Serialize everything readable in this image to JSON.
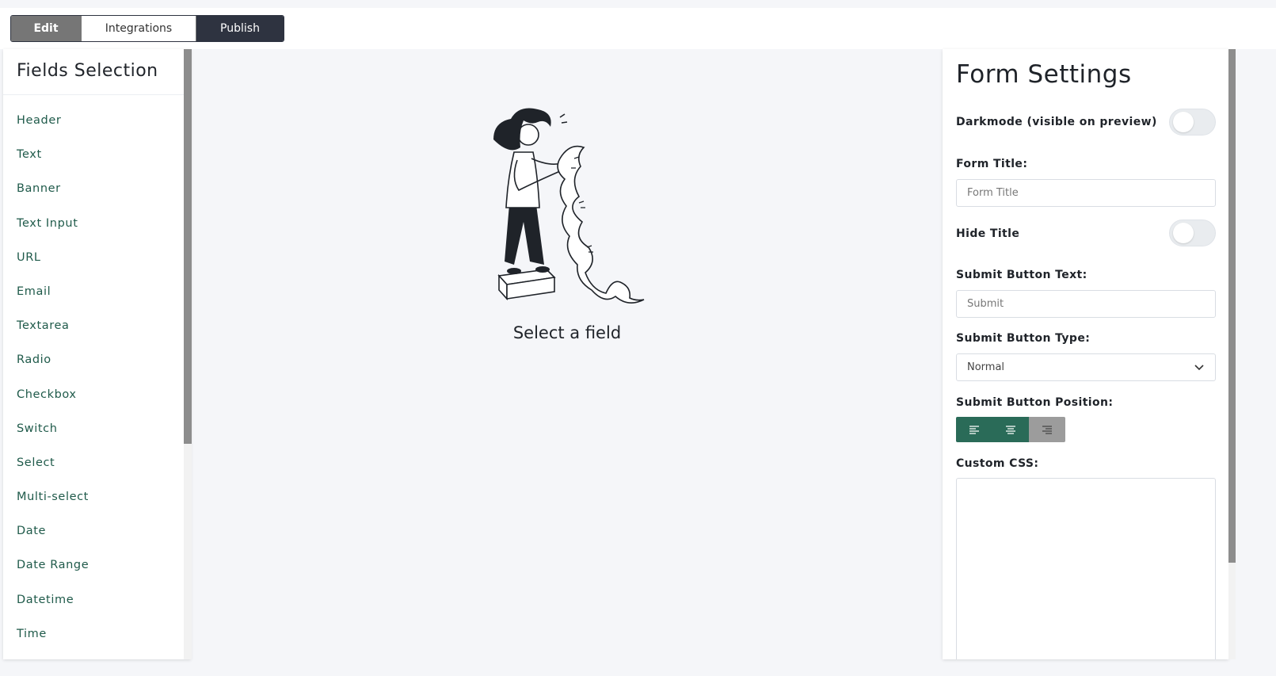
{
  "top_tabs": {
    "edit": "Edit",
    "integrations": "Integrations",
    "publish": "Publish"
  },
  "fields_panel": {
    "title": "Fields Selection",
    "items": [
      "Header",
      "Text",
      "Banner",
      "Text Input",
      "URL",
      "Email",
      "Textarea",
      "Radio",
      "Checkbox",
      "Switch",
      "Select",
      "Multi-select",
      "Date",
      "Date Range",
      "Datetime",
      "Time"
    ]
  },
  "canvas": {
    "empty_caption": "Select a field",
    "illustration": "person-reading-scroll-illustration"
  },
  "form_settings": {
    "title": "Form Settings",
    "darkmode_label": "Darkmode (visible on preview)",
    "darkmode_on": false,
    "form_title_label": "Form Title:",
    "form_title_placeholder": "Form Title",
    "hide_title_label": "Hide Title",
    "hide_title_on": false,
    "submit_text_label": "Submit Button Text:",
    "submit_text_placeholder": "Submit",
    "submit_type_label": "Submit Button Type:",
    "submit_type_value": "Normal",
    "submit_position_label": "Submit Button Position:",
    "positions": [
      "align-left",
      "align-center",
      "align-right"
    ],
    "selected_position": "align-center",
    "custom_css_label": "Custom CSS:"
  },
  "colors": {
    "accent": "#2a6b58",
    "dark": "#2e3340",
    "field_text": "#1f5a4a"
  }
}
